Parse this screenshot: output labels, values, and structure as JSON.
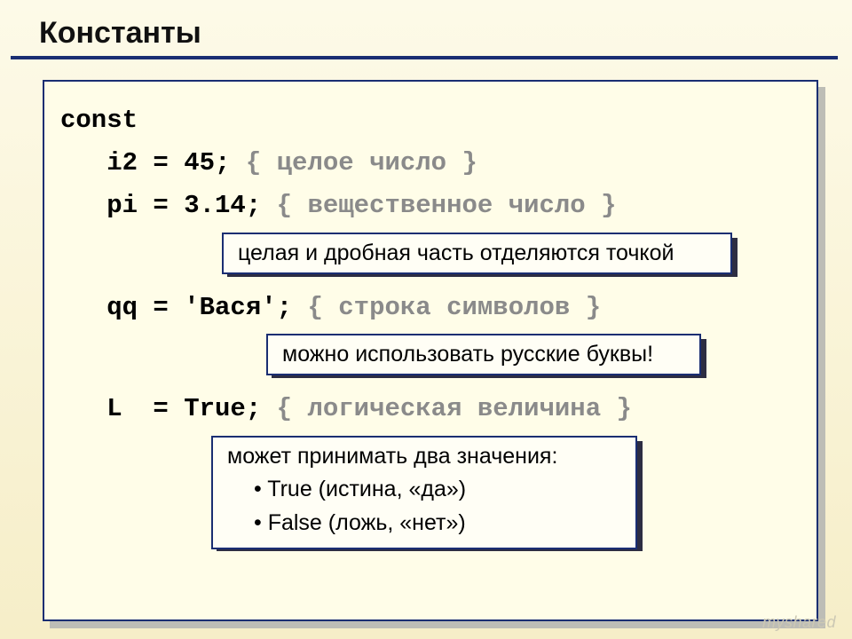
{
  "heading": "Константы",
  "code": {
    "kw": "const",
    "l1_code": "   i2 = 45; ",
    "l1_cmt": "{ целое число }",
    "l2_code": "   pi = 3.14; ",
    "l2_cmt": "{ вещественное число }",
    "l3_code": "   qq = 'Вася'; ",
    "l3_cmt": "{ строка символов }",
    "l4_code": "   L  = True; ",
    "l4_cmt": "{ логическая величина }"
  },
  "callout1": "целая и дробная часть отделяются точкой",
  "callout2": "можно использовать русские буквы!",
  "callout3": {
    "head": "может принимать два значения:",
    "b1": "True (истина, «да»)",
    "b2": "False (ложь, «нет»)"
  },
  "watermark": "myshared"
}
